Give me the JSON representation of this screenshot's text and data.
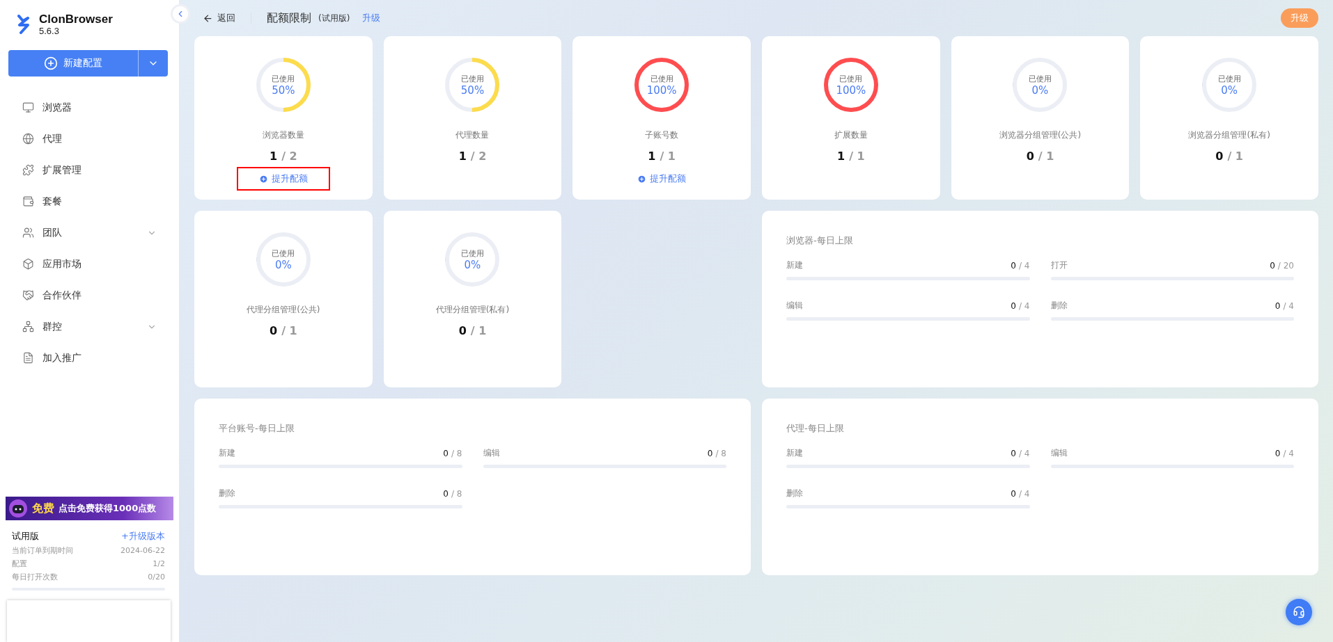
{
  "app": {
    "name": "ClonBrowser",
    "version": "5.6.3"
  },
  "new_button": {
    "label": "新建配置"
  },
  "nav": [
    {
      "label": "浏览器",
      "has_submenu": false
    },
    {
      "label": "代理",
      "has_submenu": false
    },
    {
      "label": "扩展管理",
      "has_submenu": false
    },
    {
      "label": "套餐",
      "has_submenu": false
    },
    {
      "label": "团队",
      "has_submenu": true
    },
    {
      "label": "应用市场",
      "has_submenu": false
    },
    {
      "label": "合作伙伴",
      "has_submenu": false
    },
    {
      "label": "群控",
      "has_submenu": true
    },
    {
      "label": "加入推广",
      "has_submenu": false
    }
  ],
  "promo": {
    "badge": "免费",
    "text": "点击免费获得1000点数"
  },
  "plan": {
    "name": "试用版",
    "upgrade": "+升级版本",
    "level": 0,
    "rows": [
      {
        "label": "当前订单到期时间",
        "value": "2024-06-22"
      },
      {
        "label": "配置",
        "value": "1/2"
      },
      {
        "label": "每日打开次数",
        "value": "0/20"
      }
    ]
  },
  "header": {
    "back": "返回",
    "title": "配额限制",
    "edition": "(试用版)",
    "upgrade_link": "升级",
    "upgrade_button": "升级"
  },
  "quotas": [
    {
      "caption": "已使用",
      "percent": "50%",
      "level": 0.5,
      "color": "#fcdc4c",
      "name": "浏览器数量",
      "used": "1",
      "limit": "/ 2",
      "action": "提升配额",
      "highlighted": true
    },
    {
      "caption": "已使用",
      "percent": "50%",
      "level": 0.5,
      "color": "#fcdc4c",
      "name": "代理数量",
      "used": "1",
      "limit": "/ 2"
    },
    {
      "caption": "已使用",
      "percent": "100%",
      "level": 1,
      "color": "#ff4d4f",
      "name": "子账号数",
      "used": "1",
      "limit": "/ 1",
      "action": "提升配额",
      "highlighted": false
    },
    {
      "caption": "已使用",
      "percent": "100%",
      "level": 1,
      "color": "#ff4d4f",
      "name": "扩展数量",
      "used": "1",
      "limit": "/ 1"
    },
    {
      "caption": "已使用",
      "percent": "0%",
      "level": 0,
      "name": "浏览器分组管理(公共)",
      "used": "0",
      "limit": "/ 1"
    },
    {
      "caption": "已使用",
      "percent": "0%",
      "level": 0,
      "name": "浏览器分组管理(私有)",
      "used": "0",
      "limit": "/ 1"
    },
    {
      "caption": "已使用",
      "percent": "0%",
      "level": 0,
      "name": "代理分组管理(公共)",
      "used": "0",
      "limit": "/ 1"
    },
    {
      "caption": "已使用",
      "percent": "0%",
      "level": 0,
      "name": "代理分组管理(私有)",
      "used": "0",
      "limit": "/ 1"
    }
  ],
  "daily_limits": [
    {
      "title": "浏览器-每日上限",
      "items": [
        {
          "label": "新建",
          "used": "0",
          "limit": "/ 4",
          "level": 0
        },
        {
          "label": "打开",
          "used": "0",
          "limit": "/ 20",
          "level": 0
        },
        {
          "label": "编辑",
          "used": "0",
          "limit": "/ 4",
          "level": 0
        },
        {
          "label": "删除",
          "used": "0",
          "limit": "/ 4",
          "level": 0
        }
      ]
    },
    {
      "title": "平台账号-每日上限",
      "items": [
        {
          "label": "新建",
          "used": "0",
          "limit": "/ 8",
          "level": 0
        },
        {
          "label": "编辑",
          "used": "0",
          "limit": "/ 8",
          "level": 0
        },
        {
          "label": "删除",
          "used": "0",
          "limit": "/ 8",
          "level": 0
        }
      ]
    },
    {
      "title": "代理-每日上限",
      "items": [
        {
          "label": "新建",
          "used": "0",
          "limit": "/ 4",
          "level": 0
        },
        {
          "label": "编辑",
          "used": "0",
          "limit": "/ 4",
          "level": 0
        },
        {
          "label": "删除",
          "used": "0",
          "limit": "/ 4",
          "level": 0
        }
      ]
    }
  ]
}
